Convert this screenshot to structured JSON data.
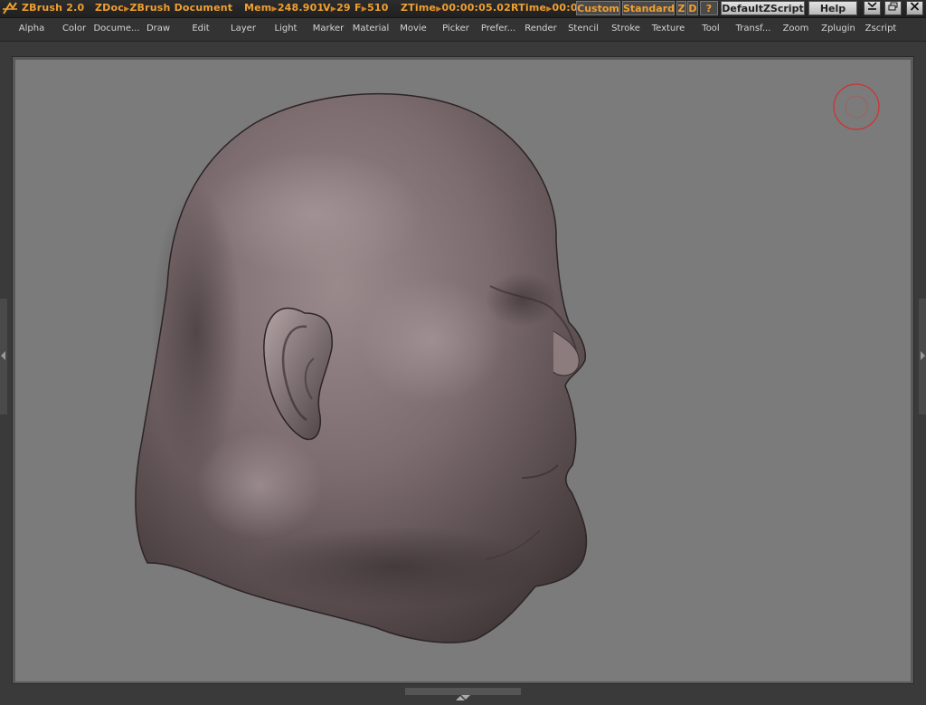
{
  "titlebar": {
    "app": "ZBrush 2.0",
    "zdoc_label": "ZDoc",
    "document": "ZBrush Document",
    "mem_label": "Mem",
    "mem_value": "248.901",
    "v_label": "V",
    "v_value": "29",
    "f_label": "F",
    "f_value": "510",
    "ztime_label": "ZTime",
    "ztime_value": "00:00:05.02",
    "rtime_label": "RTime",
    "rtime_value": "00:0",
    "buttons": {
      "custom": "Custom",
      "standard": "Standard",
      "z": "Z",
      "d": "D",
      "question": "?",
      "defaultzscript": "DefaultZScript",
      "help": "Help"
    }
  },
  "menu": [
    "Alpha",
    "Color",
    "Docume...",
    "Draw",
    "Edit",
    "Layer",
    "Light",
    "Marker",
    "Material",
    "Movie",
    "Picker",
    "Prefer...",
    "Render",
    "Stencil",
    "Stroke",
    "Texture",
    "Tool",
    "Transf...",
    "Zoom",
    "Zplugin",
    "Zscript"
  ],
  "colors": {
    "accent": "#f0a030",
    "canvas_bg": "#7b7b7b",
    "cursor": "#d03030",
    "model": "#7a6b6e"
  },
  "icons": {
    "logo": "zbrush-logo-icon",
    "minimize": "minimize-icon",
    "restore": "restore-icon",
    "close": "close-icon",
    "brush_cursor": "brush-cursor-icon"
  }
}
